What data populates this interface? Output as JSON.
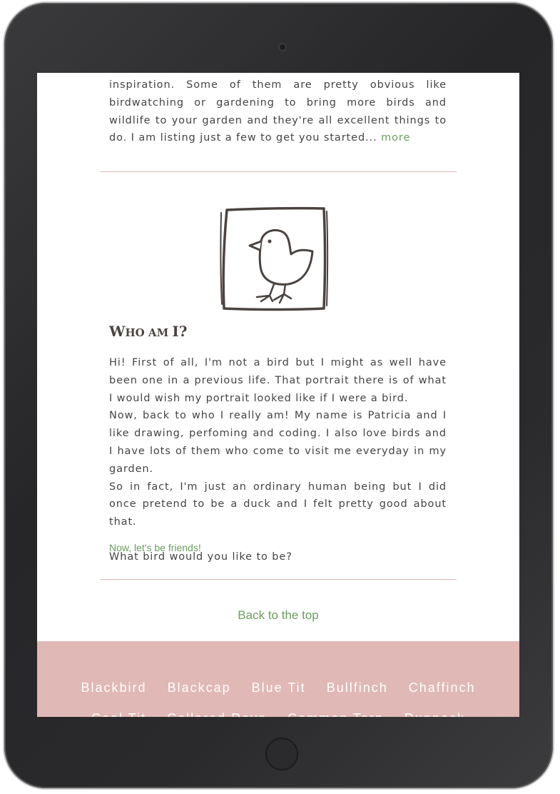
{
  "intro": {
    "text": "inspiration. Some of them are pretty obvious like birdwatching or gardening to bring more birds and wildlife to your garden and they're all excellent things to do. I am listing just a few to get you started...",
    "more_link": "more"
  },
  "about": {
    "title_first": "W",
    "title_small": "HO AM ",
    "title_end": "I?",
    "paragraph1": "Hi! First of all, I'm not a bird but I might as well have been one in a previous life. That portrait there is of what I would wish my portrait looked like if I were a bird.",
    "paragraph2": "Now, back to who I really am! My name is Patricia and I like drawing, perfoming and coding. I also love birds and I have lots of them who come to visit me everyday in my garden.",
    "paragraph3": "So in fact, I'm just an ordinary human being but I did once pretend to be a duck and I felt pretty good about that.",
    "question": "What bird would you like to be?",
    "friends_link": "Now, let's be friends!"
  },
  "back_to_top": "Back to the top",
  "footer": {
    "row1": [
      "Blackbird",
      "Blackcap",
      "Blue Tit",
      "Bullfinch",
      "Chaffinch"
    ],
    "row2": [
      "Coal Tit",
      "Collared Dove",
      "Common Tern",
      "Dunnock"
    ]
  },
  "colors": {
    "accent_green": "#6a9e5e",
    "footer_pink": "#e0b8b5",
    "divider_pink": "#e0b8b8",
    "text_gray": "#444444"
  }
}
